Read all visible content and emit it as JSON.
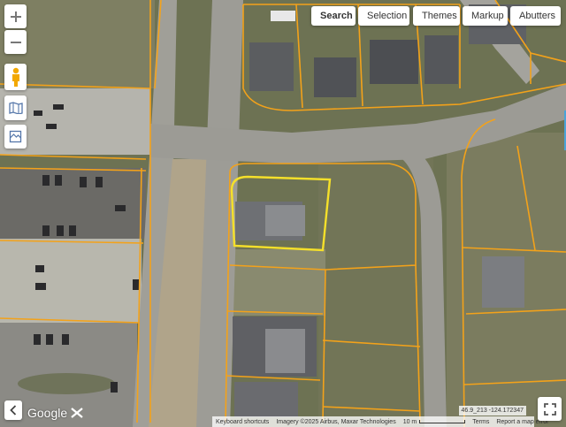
{
  "toolbar": {
    "search_label": "Search",
    "selection_label": "Selection",
    "themes_label": "Themes",
    "markup_label": "Markup",
    "abutters_label": "Abutters"
  },
  "map_controls": {
    "zoom_in": "+",
    "zoom_out": "−"
  },
  "footer": {
    "keyboard_shortcuts": "Keyboard shortcuts",
    "imagery": "Imagery ©2025 Airbus, Maxar Technologies",
    "scale_label": "10 m",
    "terms": "Terms",
    "report": "Report a map error",
    "coordinates": "46.9_213  -124.172347"
  },
  "google_logo": "Google",
  "colors": {
    "parcel_line": "#f3a21a",
    "selected_parcel": "#f5e02a",
    "road": "#9a9a96"
  }
}
